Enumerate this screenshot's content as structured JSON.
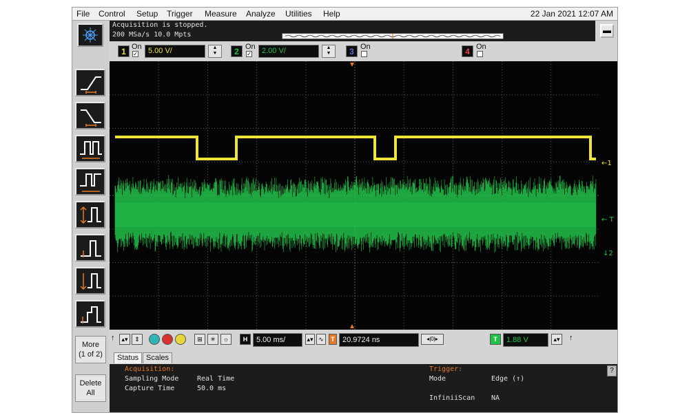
{
  "menu": [
    "File",
    "Control",
    "Setup",
    "Trigger",
    "Measure",
    "Analyze",
    "Utilities",
    "Help"
  ],
  "datetime": "22 Jan 2021 12:07 AM",
  "acquisition": {
    "line1": "Acquisition is stopped.",
    "line2": "200 MSa/s   10.0 Mpts"
  },
  "channels": [
    {
      "num": "1",
      "on_label": "On",
      "checked": "✓",
      "scale": "5.00 V/",
      "color": "#f0e43a"
    },
    {
      "num": "2",
      "on_label": "On",
      "checked": "✓",
      "scale": "2.00 V/",
      "color": "#22c24a"
    },
    {
      "num": "3",
      "on_label": "On",
      "checked": "",
      "color": "#5a6bd6"
    },
    {
      "num": "4",
      "on_label": "On",
      "checked": "",
      "color": "#e24646"
    }
  ],
  "sidebar": {
    "more_label": "More",
    "more_page": "(1 of 2)",
    "delete_label": "Delete",
    "delete_all": "All",
    "tool_icons": [
      "edge-rising-icon",
      "edge-falling-icon",
      "glitch-icon",
      "pulse-width-icon",
      "runt-icon",
      "setup-hold-icon",
      "transition-icon",
      "timeout-icon"
    ]
  },
  "timebase": {
    "h_label": "H",
    "scale": "5.00 ms/",
    "delay": "20.9724 ns",
    "trigger_label": "T",
    "trigger_level": "1.88 V"
  },
  "tabs": [
    "Status",
    "Scales"
  ],
  "status": {
    "acq_header": "Acquisition:",
    "sampling_mode_label": "Sampling Mode",
    "sampling_mode_value": "Real Time",
    "capture_time_label": "Capture Time",
    "capture_time_value": "50.0 ms",
    "trigger_header": "Trigger:",
    "mode_label": "Mode",
    "mode_value": "Edge (↑)",
    "infiniscan_label": "InfiniiScan",
    "infiniscan_value": "NA"
  },
  "help_label": "?",
  "marker_labels": {
    "ch1": "1",
    "trig": "T",
    "ch2": "2"
  },
  "colors": {
    "ch1": "#f0e43a",
    "ch2": "#22c24a",
    "grid": "#5a5a5a",
    "trigger_orange": "#e5792a"
  }
}
